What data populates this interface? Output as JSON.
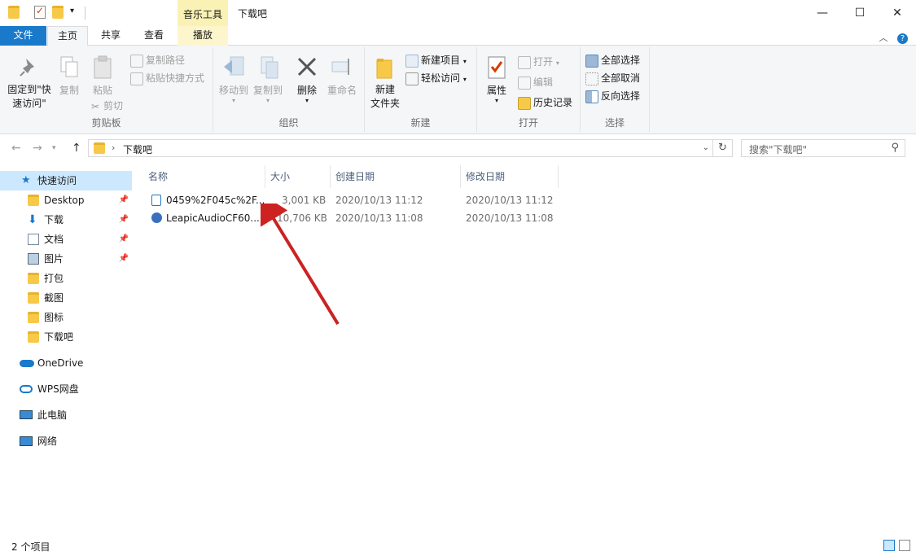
{
  "titlebar": {
    "context_tab_group": "音乐工具",
    "window_title": "下载吧",
    "minimize": "—",
    "maximize": "☐",
    "close": "✕"
  },
  "tabs": {
    "file": "文件",
    "home": "主页",
    "share": "共享",
    "view": "查看",
    "play": "播放"
  },
  "ribbon": {
    "clipboard": {
      "label": "剪贴板",
      "pin_quick_access": "固定到\"快速访问\"",
      "copy": "复制",
      "paste": "粘贴",
      "copy_path": "复制路径",
      "paste_shortcut": "粘贴快捷方式",
      "cut": "剪切"
    },
    "organize": {
      "label": "组织",
      "move_to": "移动到",
      "copy_to": "复制到",
      "delete": "删除",
      "rename": "重命名"
    },
    "new": {
      "label": "新建",
      "new_folder": "新建\n文件夹",
      "new_item": "新建项目",
      "easy_access": "轻松访问"
    },
    "open": {
      "label": "打开",
      "properties": "属性",
      "open": "打开",
      "edit": "编辑",
      "history": "历史记录"
    },
    "select": {
      "label": "选择",
      "select_all": "全部选择",
      "select_none": "全部取消",
      "invert": "反向选择"
    }
  },
  "address": {
    "path": "下载吧",
    "search_placeholder": "搜索\"下载吧\""
  },
  "sidebar": {
    "quick_access": "快速访问",
    "items": [
      {
        "label": "Desktop",
        "pinned": true
      },
      {
        "label": "下载",
        "pinned": true
      },
      {
        "label": "文档",
        "pinned": true
      },
      {
        "label": "图片",
        "pinned": true
      },
      {
        "label": "打包",
        "pinned": false
      },
      {
        "label": "截图",
        "pinned": false
      },
      {
        "label": "图标",
        "pinned": false
      },
      {
        "label": "下载吧",
        "pinned": false
      }
    ],
    "onedrive": "OneDrive",
    "wps": "WPS网盘",
    "this_pc": "此电脑",
    "network": "网络"
  },
  "columns": {
    "name": "名称",
    "size": "大小",
    "created": "创建日期",
    "modified": "修改日期"
  },
  "files": [
    {
      "name": "0459%2F045c%2F...",
      "size": "3,001 KB",
      "created": "2020/10/13 11:12",
      "modified": "2020/10/13 11:12"
    },
    {
      "name": "LeapicAudioCF60....",
      "size": "10,706 KB",
      "created": "2020/10/13 11:08",
      "modified": "2020/10/13 11:08"
    }
  ],
  "status": {
    "item_count": "2 个项目"
  },
  "colors": {
    "file_tab": "#1979ca",
    "context_tab": "#faf1b5",
    "arrow": "#cc2222"
  }
}
